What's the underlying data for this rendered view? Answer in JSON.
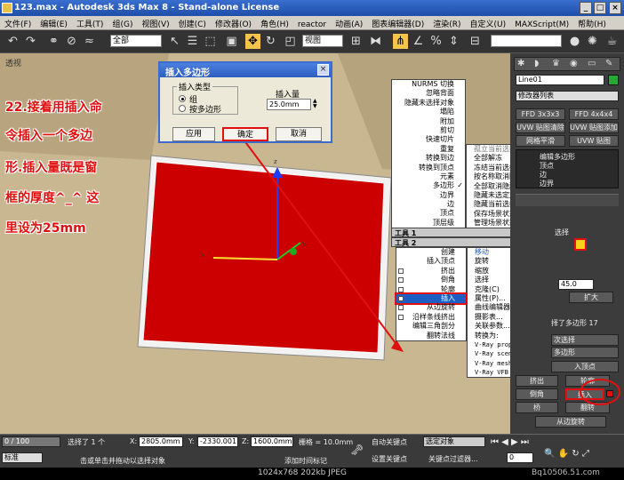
{
  "window": {
    "title": "123.max - Autodesk 3ds Max 8 - Stand-alone License",
    "btn_min": "_",
    "btn_max": "□",
    "btn_close": "×"
  },
  "menubar": [
    "文件(F)",
    "编辑(E)",
    "工具(T)",
    "组(G)",
    "视图(V)",
    "创建(C)",
    "修改器(O)",
    "角色(H)",
    "reactor",
    "动画(A)",
    "图表编辑器(D)",
    "渲染(R)",
    "自定义(U)",
    "MAXScript(M)",
    "帮助(H)"
  ],
  "toolbar": {
    "filter_select": "全部",
    "ref_coord_select": "视图",
    "icons": [
      "undo-icon",
      "redo-icon",
      "link-icon",
      "unlink-icon",
      "bind-icon",
      "select-icon",
      "select-by-name-icon",
      "region-icon",
      "move-icon",
      "rotate-icon",
      "scale-icon",
      "pivot-icon",
      "mirror-icon",
      "align-icon",
      "snap-icon",
      "angle-snap-icon",
      "percent-snap-icon",
      "render-icon"
    ]
  },
  "viewport": {
    "label": "透视",
    "bg_color": "#c9b792",
    "window_fill": "#cc0000"
  },
  "annotation": {
    "lines": [
      "22.接着用插入命",
      "令插入一个多边",
      "形.插入量既是窗",
      "框的厚度^_^ 这",
      "里设为25mm"
    ],
    "color": "#e01010"
  },
  "dialog": {
    "title": "插入多边形",
    "group_label": "插入类型",
    "option_group": "组",
    "option_polygon": "按多边形",
    "amount_label": "插入量",
    "amount_value": "25.0mm",
    "apply": "应用",
    "ok": "确定",
    "cancel": "取消"
  },
  "quad_top_left": [
    {
      "label": "NURMS 切换"
    },
    {
      "label": "忽略背面"
    },
    {
      "label": "隐藏未选择对象"
    },
    {
      "label": "塌陷"
    },
    {
      "label": "附加"
    },
    {
      "label": "剪切"
    },
    {
      "label": "快速切片"
    },
    {
      "label": "重复"
    },
    {
      "label": "转换到边"
    },
    {
      "label": "转换到顶点"
    },
    {
      "label": "元素"
    },
    {
      "label": "多边形",
      "check": "✓"
    },
    {
      "label": "边界"
    },
    {
      "label": "边"
    },
    {
      "label": "顶点"
    },
    {
      "label": "顶层级"
    }
  ],
  "quad_top_right": [
    {
      "label": "孤立当前选择"
    },
    {
      "label": "全部解冻"
    },
    {
      "label": "冻结当前选择"
    },
    {
      "label": "按名称取消隐藏"
    },
    {
      "label": "全部取消隐藏"
    },
    {
      "label": "隐藏未选定对象"
    },
    {
      "label": "隐藏当前选择"
    },
    {
      "label": "保存场景状态..."
    },
    {
      "label": "管理场景状态..."
    }
  ],
  "quad_headers": {
    "tools1": "工具 1",
    "tools2": "工具 2",
    "display": "显示",
    "transform": "变换"
  },
  "quad_bottom_left": [
    {
      "label": "创建"
    },
    {
      "label": "插入顶点"
    },
    {
      "label": "挤出"
    },
    {
      "label": "倒角"
    },
    {
      "label": "轮廓"
    },
    {
      "label": "插入",
      "hl": true
    },
    {
      "label": "从边旋转"
    },
    {
      "label": "沿样条线挤出"
    },
    {
      "label": "编辑三角剖分"
    },
    {
      "label": "翻转法线"
    }
  ],
  "quad_bottom_right": [
    {
      "label": "移动"
    },
    {
      "label": "旋转"
    },
    {
      "label": "缩放"
    },
    {
      "label": "选择"
    },
    {
      "label": "克隆(C)"
    },
    {
      "label": "属性(P)..."
    },
    {
      "label": "曲线编辑器..."
    },
    {
      "label": "摄影表..."
    },
    {
      "label": "关联参数..."
    },
    {
      "label": "转换为:"
    },
    {
      "label": "V-Ray properties"
    },
    {
      "label": "V-Ray scene converter"
    },
    {
      "label": "V-Ray mesh export"
    },
    {
      "label": "V-Ray VFB"
    }
  ],
  "panel": {
    "object_name": "Line01",
    "color_swatch": "#22aa33",
    "modifier_list": "修改器列表",
    "buttons": [
      "FFD 3x3x3",
      "FFD 4x4x4",
      "UVW 贴图清除",
      "UVW 贴图添加",
      "网格平滑",
      "UVW 贴图"
    ],
    "stack": [
      "编辑多边形",
      "顶点",
      "边",
      "边界"
    ],
    "selection": "选择",
    "spin_value": "45.0",
    "expand": "扩大",
    "selected_info": "择了多边形 17",
    "ignore_backface": "次选择",
    "poly_edit": "多边形",
    "insert_vertex": "入顶点",
    "extrude": "挤出",
    "outline": "轮廓",
    "bevel": "倒角",
    "inset": "插入",
    "bridge": "桥",
    "flip": "翻转",
    "hinge": "从边旋转"
  },
  "status": {
    "slider": "0 / 100",
    "selection_info": "选择了 1 个",
    "x_label": "X:",
    "x_value": "2805.0mm",
    "y_label": "Y:",
    "y_value": "-2330.001",
    "z_label": "Z:",
    "z_value": "1600.0mm",
    "grid": "栅格 = 10.0mm",
    "auto_key": "自动关键点",
    "selected_obj": "选定对象",
    "set_key": "设置关键点",
    "key_filter": "关键点过滤器...",
    "prompt": "击或单击并拖动以选择对象",
    "add_time_tag": "添加时间标记",
    "standard": "标准",
    "frame": "0"
  },
  "caption": {
    "info": "1024x768  202kb  JPEG",
    "watermark": "Bq10506.51.com"
  }
}
